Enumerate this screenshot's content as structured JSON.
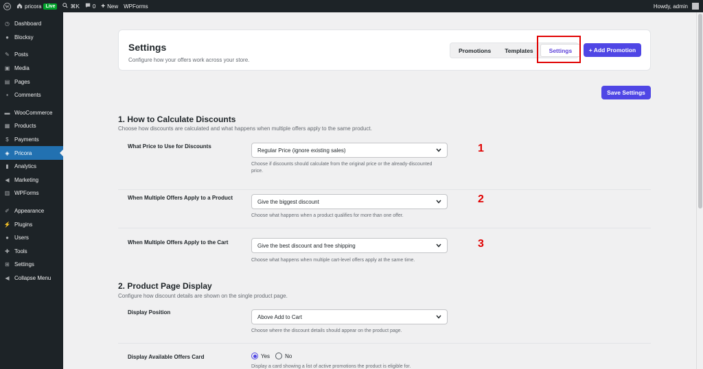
{
  "admin_bar": {
    "site_name": "pricora",
    "live_badge": "Live",
    "shortcut": "⌘K",
    "comments_count": "0",
    "new_label": "New",
    "wpforms_label": "WPForms",
    "howdy": "Howdy, admin"
  },
  "sidebar": {
    "items": [
      {
        "label": "Dashboard",
        "icon": "dashboard-icon"
      },
      {
        "label": "Blocksy",
        "icon": "blocksy-icon"
      },
      {
        "label": "Posts",
        "icon": "pin-icon"
      },
      {
        "label": "Media",
        "icon": "media-icon"
      },
      {
        "label": "Pages",
        "icon": "pages-icon"
      },
      {
        "label": "Comments",
        "icon": "comment-icon"
      },
      {
        "label": "WooCommerce",
        "icon": "woocommerce-icon"
      },
      {
        "label": "Products",
        "icon": "products-icon"
      },
      {
        "label": "Payments",
        "icon": "payments-icon"
      },
      {
        "label": "Pricora",
        "icon": "pricora-icon",
        "active": true
      },
      {
        "label": "Analytics",
        "icon": "analytics-icon"
      },
      {
        "label": "Marketing",
        "icon": "megaphone-icon"
      },
      {
        "label": "WPForms",
        "icon": "wpforms-icon"
      },
      {
        "label": "Appearance",
        "icon": "brush-icon"
      },
      {
        "label": "Plugins",
        "icon": "plugin-icon"
      },
      {
        "label": "Users",
        "icon": "users-icon"
      },
      {
        "label": "Tools",
        "icon": "wrench-icon"
      },
      {
        "label": "Settings",
        "icon": "settings-icon"
      },
      {
        "label": "Collapse Menu",
        "icon": "collapse-icon"
      }
    ]
  },
  "header": {
    "title": "Settings",
    "subtitle": "Configure how your offers work across your store.",
    "tabs": [
      "Promotions",
      "Templates",
      "Settings"
    ],
    "selected_tab": "Settings",
    "add_button": "+ Add Promotion"
  },
  "save_button": "Save Settings",
  "section1": {
    "title": "1. How to Calculate Discounts",
    "desc": "Choose how discounts are calculated and what happens when multiple offers apply to the same product.",
    "rows": [
      {
        "label": "What Price to Use for Discounts",
        "value": "Regular Price (ignore existing sales)",
        "help1": "Choose if discounts should calculate from the original price or the already-discounted",
        "help2": "price.",
        "marker": "1"
      },
      {
        "label": "When Multiple Offers Apply to a Product",
        "value": "Give the biggest discount",
        "help1": "Choose what happens when a product qualifies for more than one offer.",
        "marker": "2"
      },
      {
        "label": "When Multiple Offers Apply to the Cart",
        "value": "Give the best discount and free shipping",
        "help1": "Choose what happens when multiple cart-level offers apply at the same time.",
        "marker": "3"
      }
    ]
  },
  "section2": {
    "title": "2. Product Page Display",
    "desc": "Configure how discount details are shown on the single product page.",
    "display_position": {
      "label": "Display Position",
      "value": "Above Add to Cart",
      "help": "Choose where the discount details should appear on the product page."
    },
    "offers_card": {
      "label": "Display Available Offers Card",
      "yes": "Yes",
      "no": "No",
      "selected": "Yes",
      "help": "Display a card showing a list of active promotions the product is eligible for."
    }
  },
  "colors": {
    "accent": "#4f46e5",
    "annotation": "#e00000",
    "sidebar_bg": "#1d2327",
    "active_menu": "#2271b1"
  }
}
